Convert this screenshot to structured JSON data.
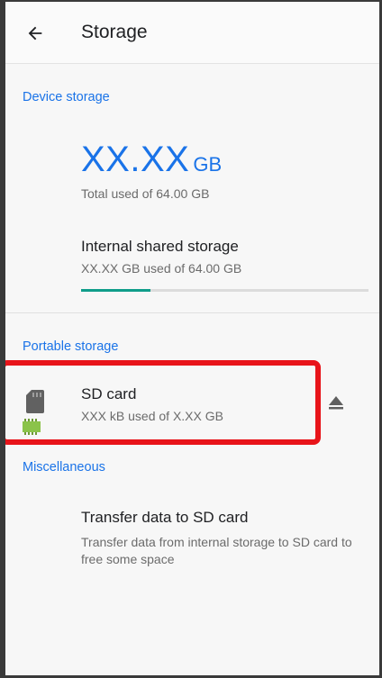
{
  "header": {
    "title": "Storage",
    "back_icon": "arrow-back-icon"
  },
  "device_storage": {
    "section_label": "Device storage",
    "total_value": "XX.XX",
    "total_unit": "GB",
    "total_caption": "Total used of 64.00 GB",
    "internal": {
      "title": "Internal shared storage",
      "summary": "XX.XX GB used of 64.00 GB",
      "icon": "chip-icon",
      "usage_fraction": 0.24,
      "usage_color": "#0f9d8a"
    }
  },
  "portable_storage": {
    "section_label": "Portable storage",
    "sd_card": {
      "title": "SD card",
      "summary": "XXX kB used of X.XX GB",
      "icon": "sd-card-icon",
      "action_icon": "eject-icon"
    }
  },
  "miscellaneous": {
    "section_label": "Miscellaneous",
    "transfer": {
      "title": "Transfer data to SD card",
      "description": "Transfer data from internal storage to SD card to free some space"
    }
  },
  "colors": {
    "accent": "#1a73e8",
    "highlight": "#e8141a",
    "chip": "#8bc34a"
  }
}
